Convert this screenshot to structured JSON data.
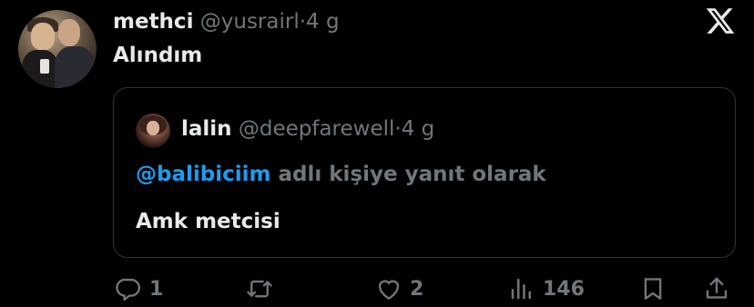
{
  "author": {
    "name": "methci",
    "handle": "@yusrairl",
    "separator": "·",
    "time": "4 g"
  },
  "tweet_text": "Alındım",
  "quoted": {
    "name": "lalin",
    "handle": "@deepfarewell",
    "separator": "·",
    "time": "4 g",
    "reply_mention": "@balibiciim",
    "reply_suffix": " adlı kişiye yanıt olarak",
    "text": "Amk metcisi"
  },
  "actions": {
    "reply_count": "1",
    "retweet_count": "",
    "like_count": "2",
    "view_count": "146"
  },
  "icons": [
    "x-logo-icon",
    "reply-icon",
    "retweet-icon",
    "like-icon",
    "views-icon",
    "bookmark-icon",
    "share-icon"
  ],
  "colors": {
    "background": "#000000",
    "text": "#e7e9ea",
    "secondary": "#71767b",
    "link": "#1d9bf0",
    "border": "#2f3336"
  }
}
